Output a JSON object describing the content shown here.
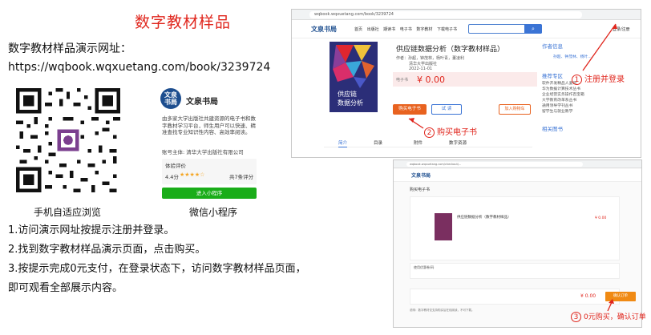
{
  "intro": {
    "title": "数字教材样品",
    "demo_label": "数字教材样品演示网址：",
    "demo_url": "https://wqbook.wqxuetang.com/book/3239724",
    "qr_caption": "手机自适应浏览",
    "mini_caption": "微信小程序"
  },
  "mini_program": {
    "logo_text": "文泉\n书局",
    "name": "文泉书局",
    "description": "由多家大学出版社共建资源的电子书和数字教材学习平台，师生用户可以快速、精准查找专业知识性内容、高效率阅读。",
    "owner": "账号主体: 清华大学出版社有限公司",
    "rating_title": "体验评价",
    "score": "4.4分",
    "stars": "★★★★☆",
    "rating_count": "共7条评分",
    "enter_button": "进入小程序"
  },
  "steps": [
    "1.访问演示网址按提示注册并登录。",
    "2.找到数字教材样品演示页面，点击购买。",
    "3.按提示完成0元支付，在登录状态下，访问数字教材样品页面，",
    "即可观看全部展示内容。"
  ],
  "screenshot1": {
    "url": "wqbook.wqxuetang.com/book/3239724",
    "brand": "文泉书局",
    "menu": "首页 出版社 期读书 电子书 数字教材 下载电子书",
    "login": "登录/注册",
    "book_title": "供应链数据分析（数字教材样品）",
    "cover_title": "供应链\n数据分析",
    "authors": "作者：孙超，钟茂林，杨叶青，董凌利",
    "publisher": "清华大学出版社",
    "date": "2022-11-01",
    "price_label": "电子书",
    "price": "¥ 0.00",
    "buy_button": "购买电子书",
    "trial_button": "试 读",
    "cart_button": "加入购物车",
    "tabs": [
      "简介",
      "目录",
      "附件",
      "数字资源"
    ],
    "side_author_head": "作者信息",
    "side_author": "孙超、钟茂林、杨叶...",
    "side_recommend_head": "推荐专区",
    "side_recommend": [
      "软件开发精品人妻哥",
      "华为数据计算技术丛书",
      "企业经营实务操作百宝箱",
      "大学教育改革系丛书",
      "通用领导学刊丛书",
      "留学生与就业教学"
    ],
    "side_related_head": "相关图书",
    "annotation_login": "注册并登录",
    "annotation_buy": "购买电子书"
  },
  "screenshot2": {
    "url": "wqbook.wqxuetang.com/checkout/...",
    "brand": "文泉书局",
    "header": "购买电子书",
    "book_title": "供应链数据分析（数字教材样品）",
    "price_small": "¥ 0.00",
    "coupon": "使用优惠卷/码",
    "pay_price": "¥ 0.00",
    "pay_button": "确认订单",
    "notes": "说明：数字教材仅支持购买后在线阅读，不可下载。",
    "annotation_pay": "0元购买，确认订单"
  },
  "colors": {
    "accent_red": "#e0261d",
    "brand_blue": "#1d4e8f",
    "buy_orange": "#e8621f",
    "wechat_green": "#1aad19"
  }
}
